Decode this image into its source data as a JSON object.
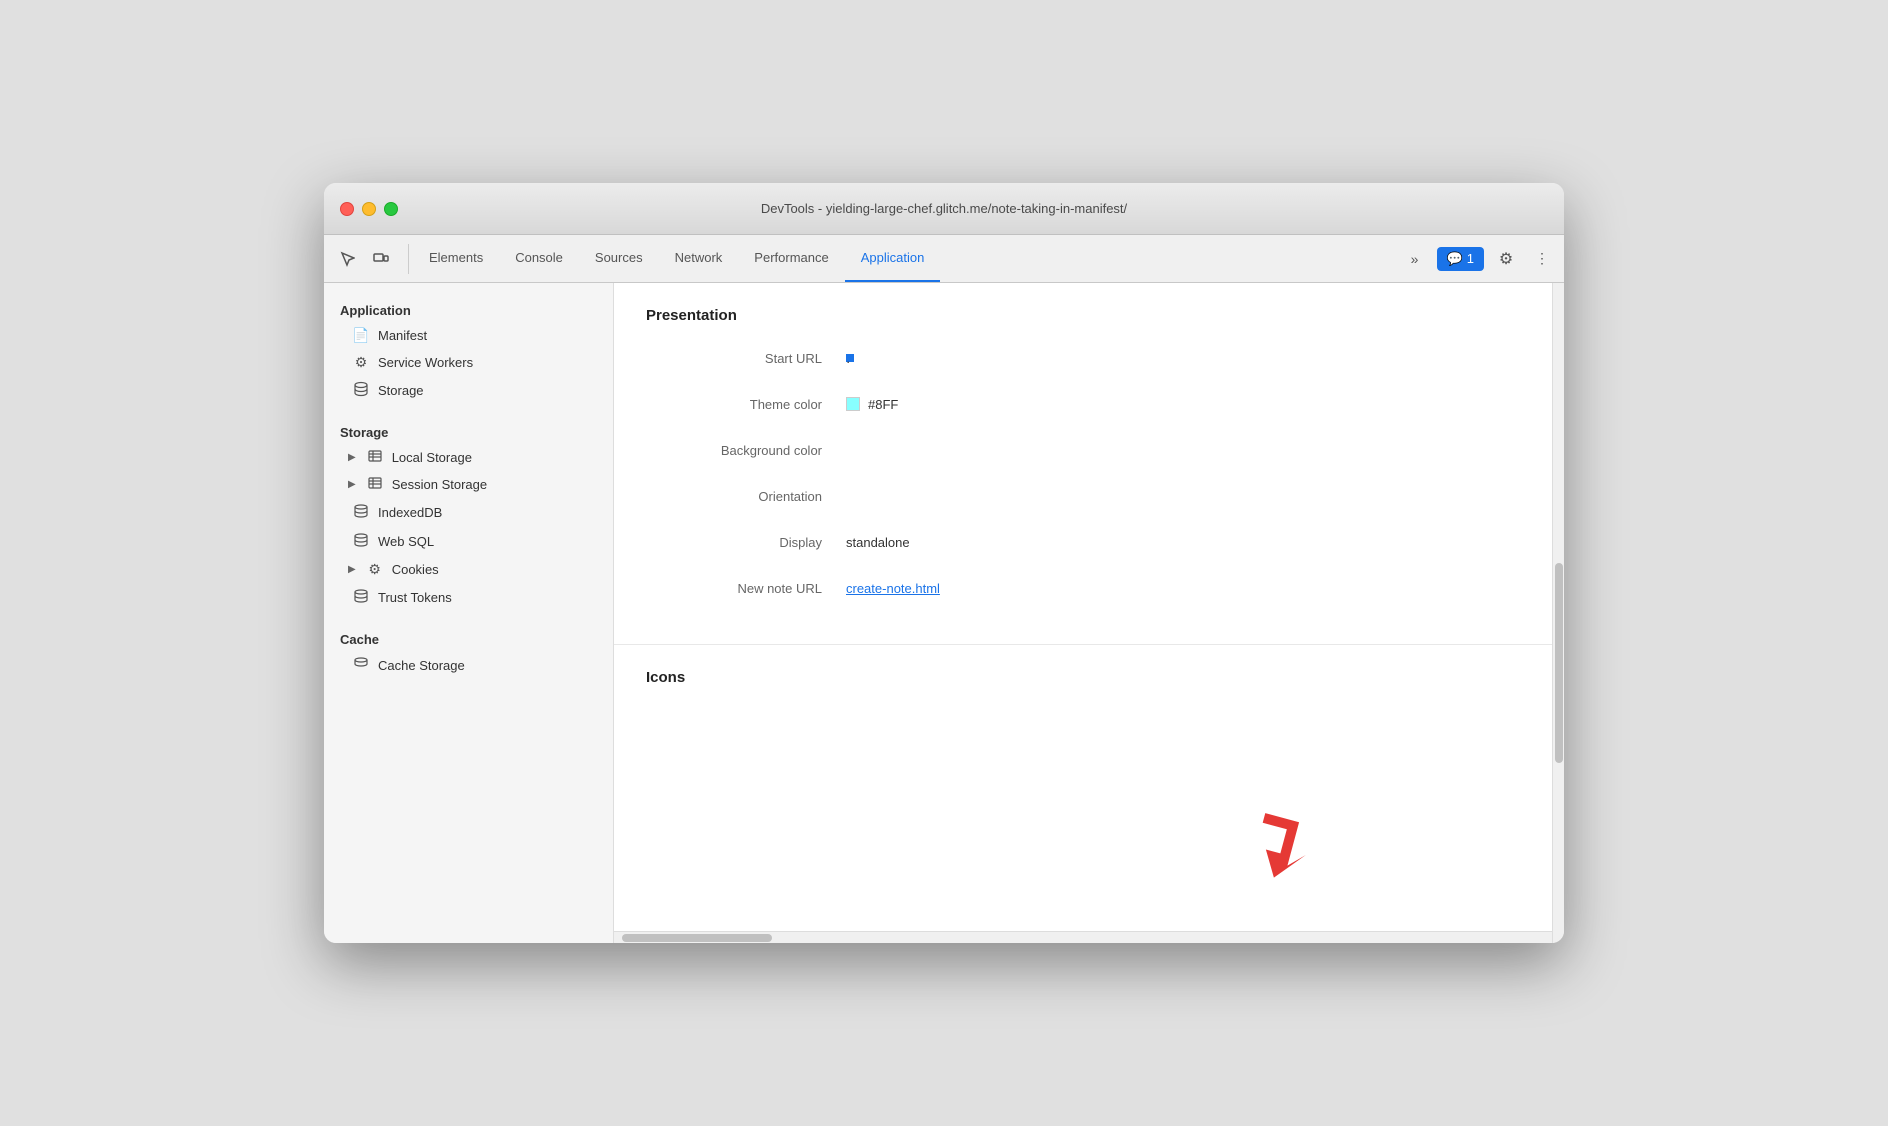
{
  "window": {
    "title": "DevTools - yielding-large-chef.glitch.me/note-taking-in-manifest/"
  },
  "toolbar": {
    "tabs": [
      {
        "id": "elements",
        "label": "Elements",
        "active": false
      },
      {
        "id": "console",
        "label": "Console",
        "active": false
      },
      {
        "id": "sources",
        "label": "Sources",
        "active": false
      },
      {
        "id": "network",
        "label": "Network",
        "active": false
      },
      {
        "id": "performance",
        "label": "Performance",
        "active": false
      },
      {
        "id": "application",
        "label": "Application",
        "active": true
      }
    ],
    "more_label": "»",
    "chat_count": "1",
    "settings_icon": "⚙",
    "more_dots": "⋮"
  },
  "sidebar": {
    "app_section": "Application",
    "app_items": [
      {
        "id": "manifest",
        "label": "Manifest",
        "icon": "📄",
        "active": false
      },
      {
        "id": "service-workers",
        "label": "Service Workers",
        "icon": "⚙",
        "active": false
      },
      {
        "id": "storage",
        "label": "Storage",
        "icon": "🗄",
        "active": false
      }
    ],
    "storage_section": "Storage",
    "storage_items": [
      {
        "id": "local-storage",
        "label": "Local Storage",
        "icon": "☰",
        "expandable": true
      },
      {
        "id": "session-storage",
        "label": "Session Storage",
        "icon": "☰",
        "expandable": true
      },
      {
        "id": "indexeddb",
        "label": "IndexedDB",
        "icon": "🗄",
        "expandable": false
      },
      {
        "id": "web-sql",
        "label": "Web SQL",
        "icon": "🗄",
        "expandable": false
      },
      {
        "id": "cookies",
        "label": "Cookies",
        "icon": "⚙",
        "expandable": true
      },
      {
        "id": "trust-tokens",
        "label": "Trust Tokens",
        "icon": "🗄",
        "expandable": false
      }
    ],
    "cache_section": "Cache",
    "cache_items": [
      {
        "id": "cache-storage",
        "label": "Cache Storage",
        "icon": "🗄",
        "expandable": false
      }
    ]
  },
  "panel": {
    "presentation_title": "Presentation",
    "properties": [
      {
        "id": "start-url",
        "label": "Start URL",
        "value": "·",
        "type": "dot"
      },
      {
        "id": "theme-color",
        "label": "Theme color",
        "value": "#8FF",
        "color": "#8ff",
        "type": "color"
      },
      {
        "id": "background-color",
        "label": "Background color",
        "value": "",
        "type": "text"
      },
      {
        "id": "orientation",
        "label": "Orientation",
        "value": "",
        "type": "text"
      },
      {
        "id": "display",
        "label": "Display",
        "value": "standalone",
        "type": "text"
      },
      {
        "id": "new-note-url",
        "label": "New note URL",
        "value": "create-note.html",
        "type": "link"
      }
    ],
    "icons_title": "Icons"
  }
}
